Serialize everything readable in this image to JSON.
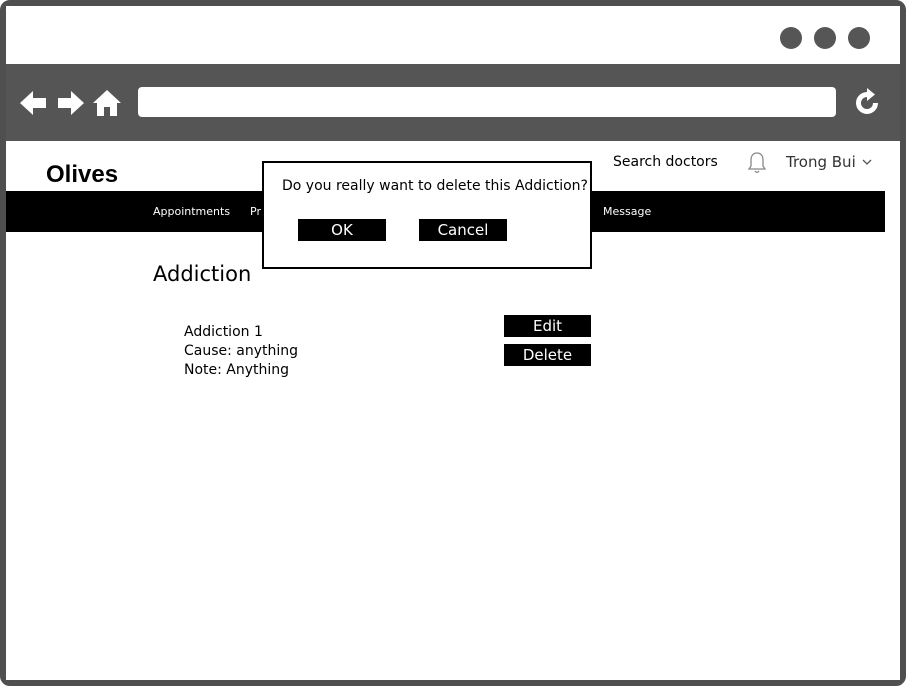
{
  "browser": {
    "window_dots": [
      "minimize",
      "maximize",
      "close"
    ],
    "nav_icons": [
      "back-arrow-icon",
      "forward-arrow-icon",
      "home-icon",
      "refresh-icon"
    ],
    "url": ""
  },
  "header": {
    "logo": "Olives",
    "search_link": "Search doctors",
    "notification_icon": "bell-icon",
    "user_name": "Trong Bui",
    "user_chevron_icon": "chevron-down-icon"
  },
  "nav": {
    "items": [
      {
        "label": "Appointments"
      },
      {
        "label": "Pr"
      },
      {
        "label": "Message"
      }
    ]
  },
  "main": {
    "title": "Addiction",
    "record": {
      "name": "Addiction 1",
      "cause": "Cause: anything",
      "note": "Note: Anything"
    },
    "edit_label": "Edit",
    "delete_label": "Delete"
  },
  "dialog": {
    "message": "Do you really want to delete this Addiction?",
    "ok_label": "OK",
    "cancel_label": "Cancel"
  },
  "colors": {
    "frame": "#4f4f4f",
    "toolbar": "#555555",
    "nav_bar": "#000000",
    "button": "#000000",
    "button_text": "#ffffff"
  }
}
